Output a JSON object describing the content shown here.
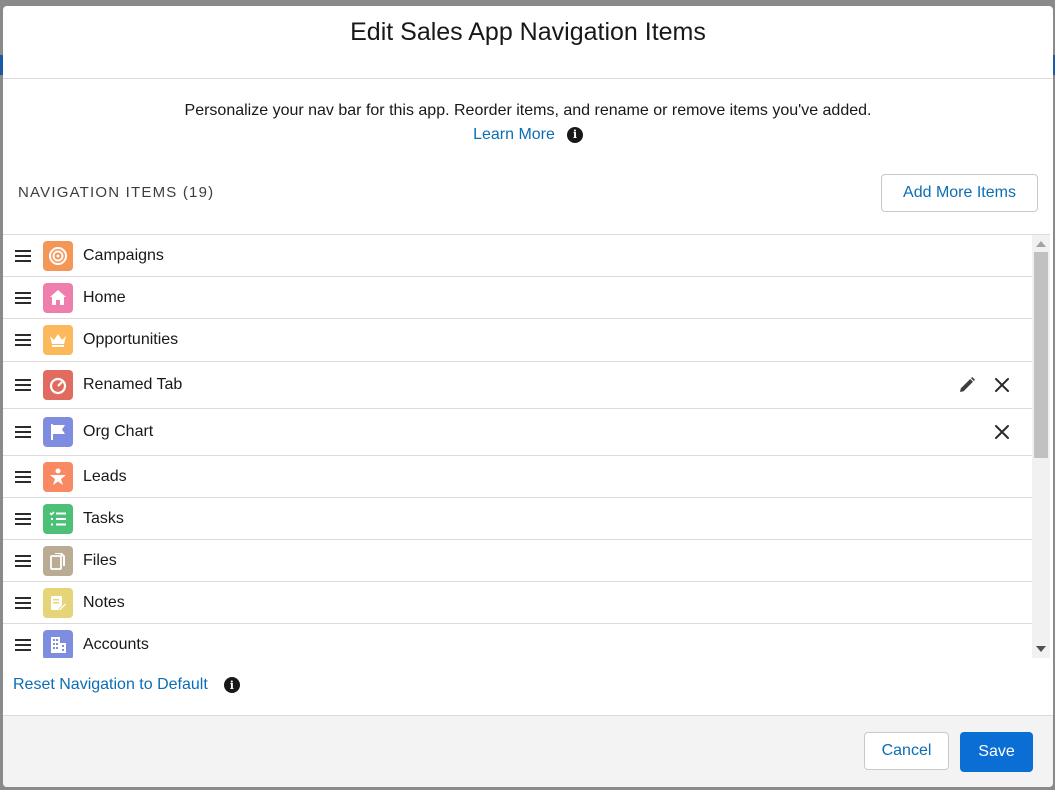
{
  "modal": {
    "title": "Edit Sales App Navigation Items",
    "intro_text": "Personalize your nav bar for this app. Reorder items, and rename or remove items you've added.",
    "learn_more": "Learn More"
  },
  "section": {
    "title": "NAVIGATION ITEMS (19)",
    "add_more_label": "Add More Items"
  },
  "items": [
    {
      "label": "Campaigns",
      "icon": "campaign-target-icon",
      "color": "#f49756",
      "editable": false,
      "removable": false
    },
    {
      "label": "Home",
      "icon": "home-icon",
      "color": "#ef7ead",
      "editable": false,
      "removable": false
    },
    {
      "label": "Opportunities",
      "icon": "crown-icon",
      "color": "#fcb95b",
      "editable": false,
      "removable": false
    },
    {
      "label": "Renamed Tab",
      "icon": "dashboard-gauge-icon",
      "color": "#e16b5e",
      "editable": true,
      "removable": true
    },
    {
      "label": "Org Chart",
      "icon": "flag-icon",
      "color": "#7f8de1",
      "editable": false,
      "removable": true
    },
    {
      "label": "Leads",
      "icon": "lead-star-person-icon",
      "color": "#f88962",
      "editable": false,
      "removable": false
    },
    {
      "label": "Tasks",
      "icon": "checklist-icon",
      "color": "#4bc076",
      "editable": false,
      "removable": false
    },
    {
      "label": "Files",
      "icon": "files-icon",
      "color": "#baac93",
      "editable": false,
      "removable": false
    },
    {
      "label": "Notes",
      "icon": "note-pencil-icon",
      "color": "#e6d478",
      "editable": false,
      "removable": false
    },
    {
      "label": "Accounts",
      "icon": "building-icon",
      "color": "#7f8de1",
      "editable": false,
      "removable": false
    }
  ],
  "reset": {
    "label": "Reset Navigation to Default"
  },
  "footer": {
    "cancel_label": "Cancel",
    "save_label": "Save"
  },
  "colors": {
    "link": "#0b6eb4",
    "primary_button": "#0b6ed4"
  }
}
